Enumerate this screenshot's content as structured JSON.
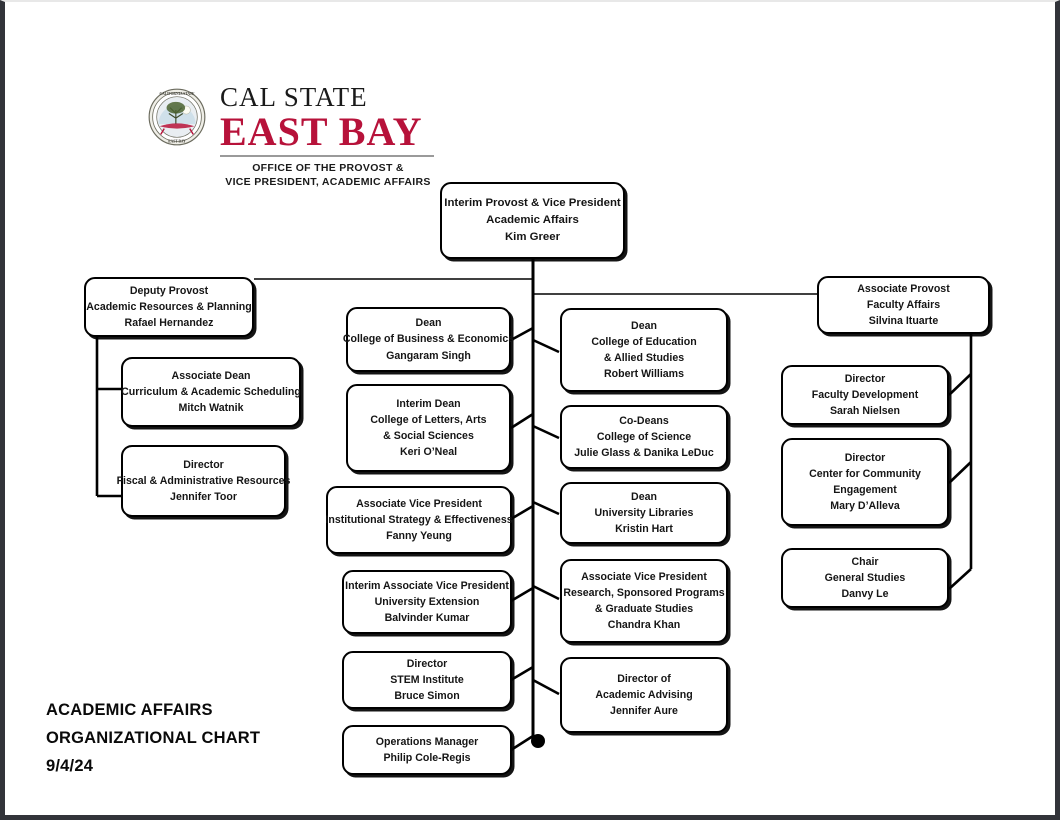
{
  "document": {
    "title_lines": [
      "ACADEMIC AFFAIRS",
      "ORGANIZATIONAL CHART",
      "9/4/24"
    ],
    "accent_color": "#b7123a",
    "line_color": "#000000",
    "background": "#ffffff"
  },
  "logo": {
    "seal_alt": "university-seal",
    "line1": "CAL STATE",
    "line2": "EAST BAY",
    "office_line1": "OFFICE OF THE PROVOST &",
    "office_line2": "VICE PRESIDENT, ACADEMIC AFFAIRS"
  },
  "chart_data": {
    "type": "diagram",
    "diagram_kind": "organizational-chart",
    "root": "interim-provost",
    "nodes": [
      {
        "id": "interim-provost",
        "column": "center",
        "lines": [
          "Interim Provost & Vice President",
          "Academic Affairs",
          "Kim Greer"
        ],
        "title": "Interim Provost & Vice President",
        "unit": "Academic Affairs",
        "person": "Kim Greer"
      },
      {
        "id": "deputy-provost",
        "column": "left",
        "parent": "interim-provost",
        "lines": [
          "Deputy Provost",
          "Academic Resources & Planning",
          "Rafael Hernandez"
        ],
        "title": "Deputy Provost",
        "unit": "Academic Resources & Planning",
        "person": "Rafael Hernandez"
      },
      {
        "id": "associate-dean-curriculum",
        "column": "left",
        "parent": "deputy-provost",
        "lines": [
          "Associate Dean",
          "Curriculum & Academic Scheduling",
          "Mitch Watnik"
        ],
        "title": "Associate Dean",
        "unit": "Curriculum & Academic Scheduling",
        "person": "Mitch Watnik"
      },
      {
        "id": "director-fiscal",
        "column": "left",
        "parent": "deputy-provost",
        "lines": [
          "Director",
          "Fiscal & Administrative Resources",
          "Jennifer Toor"
        ],
        "title": "Director",
        "unit": "Fiscal & Administrative Resources",
        "person": "Jennifer Toor"
      },
      {
        "id": "associate-provost",
        "column": "right",
        "parent": "interim-provost",
        "lines": [
          "Associate Provost",
          "Faculty Affairs",
          "Silvina Ituarte"
        ],
        "title": "Associate Provost",
        "unit": "Faculty Affairs",
        "person": "Silvina Ituarte"
      },
      {
        "id": "director-faculty-development",
        "column": "right",
        "parent": "associate-provost",
        "lines": [
          "Director",
          "Faculty Development",
          "Sarah Nielsen"
        ],
        "title": "Director",
        "unit": "Faculty Development",
        "person": "Sarah Nielsen"
      },
      {
        "id": "director-community-engagement",
        "column": "right",
        "parent": "associate-provost",
        "lines": [
          "Director",
          "Center for Community",
          "Engagement",
          "Mary D’Alleva"
        ],
        "title": "Director",
        "unit": "Center for Community Engagement",
        "person": "Mary D’Alleva"
      },
      {
        "id": "chair-general-studies",
        "column": "right",
        "parent": "associate-provost",
        "lines": [
          "Chair",
          "General Studies",
          "Danvy Le"
        ],
        "title": "Chair",
        "unit": "General Studies",
        "person": "Danvy Le"
      },
      {
        "id": "dean-business",
        "column": "center-left",
        "parent": "interim-provost",
        "lines": [
          "Dean",
          "College of  Business & Economics",
          "Gangaram Singh"
        ],
        "title": "Dean",
        "unit": "College of Business & Economics",
        "person": "Gangaram Singh"
      },
      {
        "id": "interim-dean-class",
        "column": "center-left",
        "parent": "interim-provost",
        "lines": [
          "Interim Dean",
          "College of  Letters, Arts",
          "& Social Sciences",
          "Keri O’Neal"
        ],
        "title": "Interim Dean",
        "unit": "College of Letters, Arts & Social Sciences",
        "person": "Keri O’Neal"
      },
      {
        "id": "avp-institutional-strategy",
        "column": "center-left",
        "parent": "interim-provost",
        "lines": [
          "Associate Vice President",
          "Institutional Strategy & Effectiveness",
          "Fanny Yeung"
        ],
        "title": "Associate Vice President",
        "unit": "Institutional Strategy & Effectiveness",
        "person": "Fanny Yeung"
      },
      {
        "id": "interim-avp-extension",
        "column": "center-left",
        "parent": "interim-provost",
        "lines": [
          "Interim Associate Vice President",
          "University Extension",
          "Balvinder Kumar"
        ],
        "title": "Interim Associate Vice President",
        "unit": "University Extension",
        "person": "Balvinder Kumar"
      },
      {
        "id": "director-stem-institute",
        "column": "center-left",
        "parent": "interim-provost",
        "lines": [
          "Director",
          "STEM Institute",
          "Bruce Simon"
        ],
        "title": "Director",
        "unit": "STEM Institute",
        "person": "Bruce Simon"
      },
      {
        "id": "operations-manager",
        "column": "center-left",
        "parent": "interim-provost",
        "lines": [
          "Operations Manager",
          "Philip Cole-Regis"
        ],
        "title": "Operations Manager",
        "unit": "",
        "person": "Philip Cole-Regis"
      },
      {
        "id": "dean-education",
        "column": "center-right",
        "parent": "interim-provost",
        "lines": [
          "Dean",
          "College of  Education",
          "& Allied Studies",
          "Robert Williams"
        ],
        "title": "Dean",
        "unit": "College of Education & Allied Studies",
        "person": "Robert Williams"
      },
      {
        "id": "co-deans-science",
        "column": "center-right",
        "parent": "interim-provost",
        "lines": [
          "Co-Deans",
          "College of  Science",
          "Julie Glass & Danika LeDuc"
        ],
        "title": "Co-Deans",
        "unit": "College of Science",
        "person": "Julie Glass & Danika LeDuc"
      },
      {
        "id": "dean-libraries",
        "column": "center-right",
        "parent": "interim-provost",
        "lines": [
          "Dean",
          "University Libraries",
          "Kristin Hart"
        ],
        "title": "Dean",
        "unit": "University Libraries",
        "person": "Kristin Hart"
      },
      {
        "id": "avp-research",
        "column": "center-right",
        "parent": "interim-provost",
        "lines": [
          "Associate Vice President",
          "Research, Sponsored Programs",
          "& Graduate Studies",
          "Chandra Khan"
        ],
        "title": "Associate Vice President",
        "unit": "Research, Sponsored Programs & Graduate Studies",
        "person": "Chandra Khan"
      },
      {
        "id": "director-academic-advising",
        "column": "center-right",
        "parent": "interim-provost",
        "lines": [
          "Director of",
          "Academic Advising",
          "Jennifer Aure"
        ],
        "title": "Director of Academic Advising",
        "unit": "",
        "person": "Jennifer Aure"
      }
    ]
  }
}
